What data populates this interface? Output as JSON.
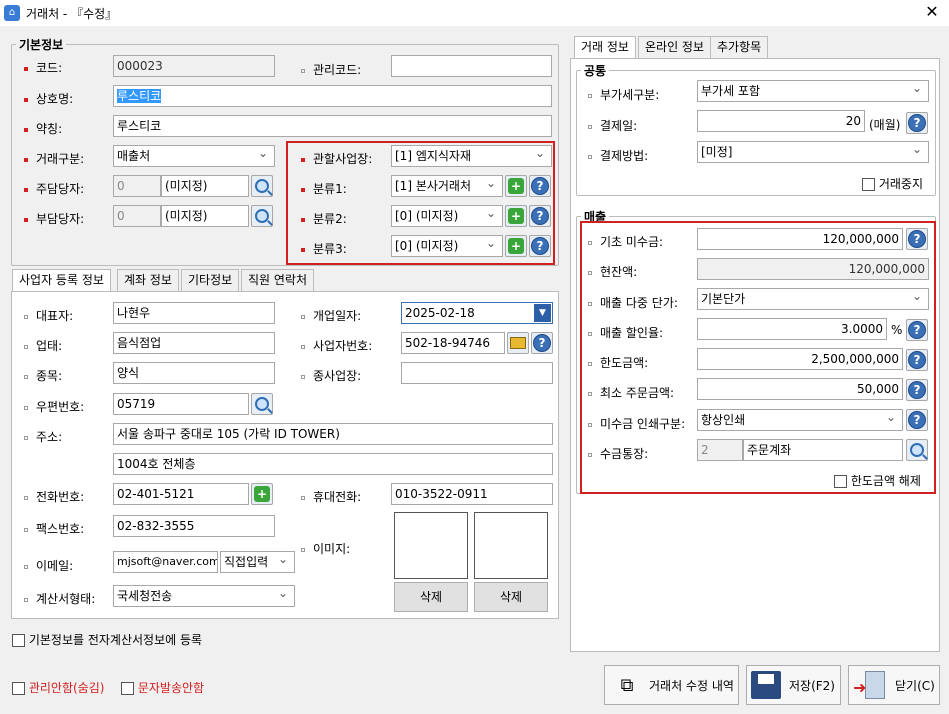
{
  "window": {
    "title": "거래처 - 『수정』",
    "close": "✕"
  },
  "basic": {
    "title": "기본정보",
    "code_label": "코드:",
    "code": "000023",
    "mgmt_label": "관리코드:",
    "mgmt": "",
    "name_label": "상호명:",
    "name": "루스티코",
    "short_label": "약칭:",
    "short": "루스티코",
    "type_label": "거래구분:",
    "type": "매출처",
    "main_mgr_label": "주담당자:",
    "main_mgr_no": "0",
    "main_mgr": "(미지정)",
    "sub_mgr_label": "부담당자:",
    "sub_mgr_no": "0",
    "sub_mgr": "(미지정)",
    "biz_label": "관할사업장:",
    "biz": "[1] 엠지식자재",
    "cat1_label": "분류1:",
    "cat1": "[1] 본사거래처",
    "cat2_label": "분류2:",
    "cat2": "[0] (미지정)",
    "cat3_label": "분류3:",
    "cat3": "[0] (미지정)"
  },
  "lower_tabs": [
    "사업자 등록 정보",
    "계좌 정보",
    "기타정보",
    "직원 연락처"
  ],
  "reg": {
    "rep_label": "대표자:",
    "rep": "나현우",
    "open_label": "개업일자:",
    "open": "2025-02-18",
    "biztype_label": "업태:",
    "biztype": "음식점업",
    "bizno_label": "사업자번호:",
    "bizno": "502-18-94746",
    "item_label": "종목:",
    "item": "양식",
    "branch_label": "종사업장:",
    "branch": "",
    "zip_label": "우편번호:",
    "zip": "05719",
    "addr_label": "주소:",
    "addr1": "서울 송파구 중대로 105 (가락 ID TOWER)",
    "addr2": "1004호 전체층",
    "tel_label": "전화번호:",
    "tel": "02-401-5121",
    "mobile_label": "휴대전화:",
    "mobile": "010-3522-0911",
    "fax_label": "팩스번호:",
    "fax": "02-832-3555",
    "image_label": "이미지:",
    "email_label": "이메일:",
    "email": "mjsoft@naver.com",
    "email_mode": "직접입력",
    "invoice_label": "계산서형태:",
    "invoice": "국세청전송",
    "delete1": "삭제",
    "delete2": "삭제"
  },
  "register_check": "기본정보를 전자계산서정보에 등록",
  "hide_check": "관리안함(숨김)",
  "sms_check": "문자발송안함",
  "right_tabs": [
    "거래 정보",
    "온라인 정보",
    "추가항목"
  ],
  "common": {
    "title": "공통",
    "vat_label": "부가세구분:",
    "vat": "부가세 포함",
    "payday_label": "결제일:",
    "payday": "20",
    "payday_unit": "(매월)",
    "paymethod_label": "결제방법:",
    "paymethod": "[미정]",
    "stop_label": "거래중지"
  },
  "sales": {
    "title": "매출",
    "open_bal_label": "기초 미수금:",
    "open_bal": "120,000,000",
    "cur_bal_label": "현잔액:",
    "cur_bal": "120,000,000",
    "price_label": "매출 다중 단가:",
    "price": "기본단가",
    "disc_label": "매출 할인율:",
    "disc": "3.0000",
    "disc_unit": "%",
    "limit_label": "한도금액:",
    "limit": "2,500,000,000",
    "min_label": "최소 주문금액:",
    "min": "50,000",
    "print_label": "미수금 인쇄구분:",
    "print": "항상인쇄",
    "acct_label": "수금통장:",
    "acct_no": "2",
    "acct": "주문계좌",
    "release_label": "한도금액 해제"
  },
  "buttons": {
    "history": "거래처 수정 내역",
    "save": "저장(F2)",
    "close": "닫기(C)"
  },
  "colors": {
    "highlight": "#3399ff",
    "accent_red": "#d21f1f"
  }
}
